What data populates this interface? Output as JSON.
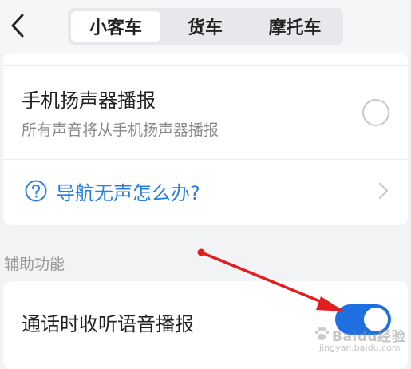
{
  "header": {
    "tabs": [
      {
        "label": "小客车",
        "active": true
      },
      {
        "label": "货车",
        "active": false
      },
      {
        "label": "摩托车",
        "active": false
      }
    ]
  },
  "speaker_option": {
    "title": "手机扬声器播报",
    "subtitle": "所有声音将从手机扬声器播报",
    "selected": false
  },
  "help_link": {
    "label": "导航无声怎么办?"
  },
  "assist_section": {
    "label": "辅助功能",
    "call_listen": {
      "title": "通话时收听语音播报",
      "enabled": true
    }
  },
  "watermark": {
    "brand": "Baidu经验",
    "url": "jingyan.baidu.com"
  },
  "colors": {
    "accent": "#1e6fe0",
    "link": "#2b7fe0",
    "annotation_arrow": "#e02020"
  }
}
